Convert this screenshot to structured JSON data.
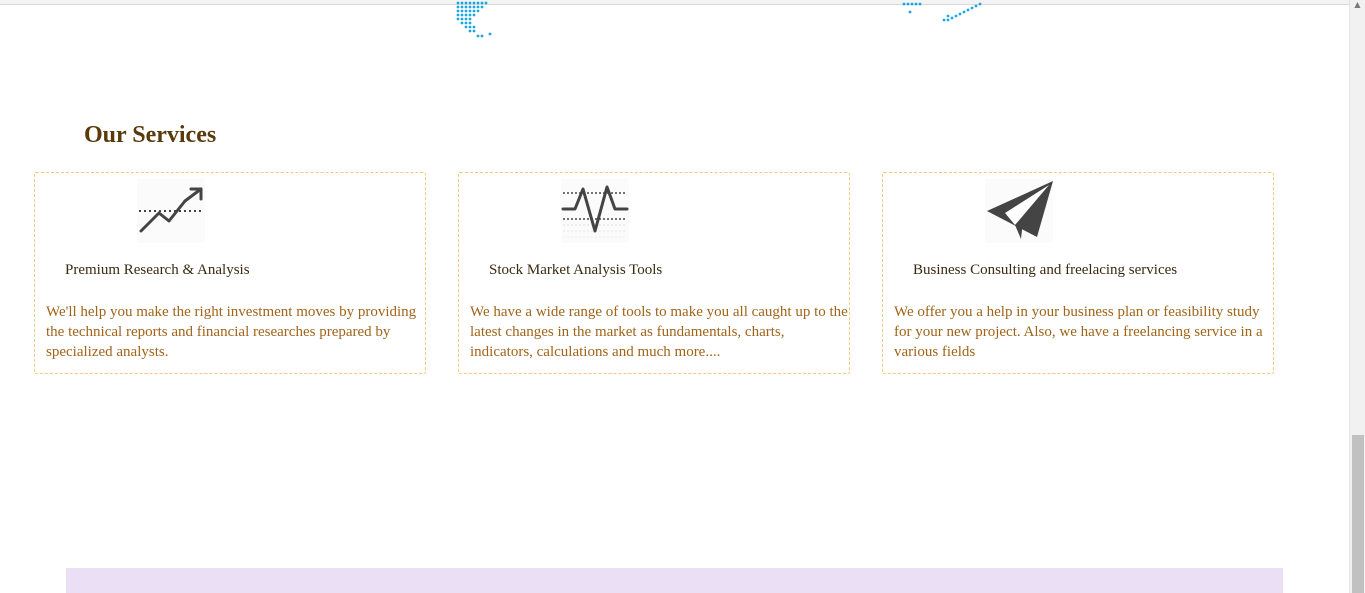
{
  "services": {
    "title": "Our Services",
    "cards": [
      {
        "icon": "trend-chart-icon",
        "title": "Premium Research & Analysis",
        "description": "We'll help you make the right investment moves by providing the technical reports and financial researches prepared by specialized analysts."
      },
      {
        "icon": "heartbeat-chart-icon",
        "title": "Stock Market Analysis Tools",
        "description": "We have a wide range of tools to make you all caught up to the latest changes in the market as fundamentals, charts, indicators, calculations and much more...."
      },
      {
        "icon": "paper-plane-icon",
        "title": "Business Consulting and freelacing services",
        "description": "We offer you a help in your business plan or feasibility study for your new project. Also, we have a freelancing service in a various fields"
      }
    ]
  },
  "colors": {
    "heading": "#5a3a0a",
    "card_title": "#3b2a10",
    "card_desc": "#a0641a",
    "card_border": "#f5c97a",
    "map_dots": "#1aa8e0",
    "footer_band": "#ebdff5"
  }
}
